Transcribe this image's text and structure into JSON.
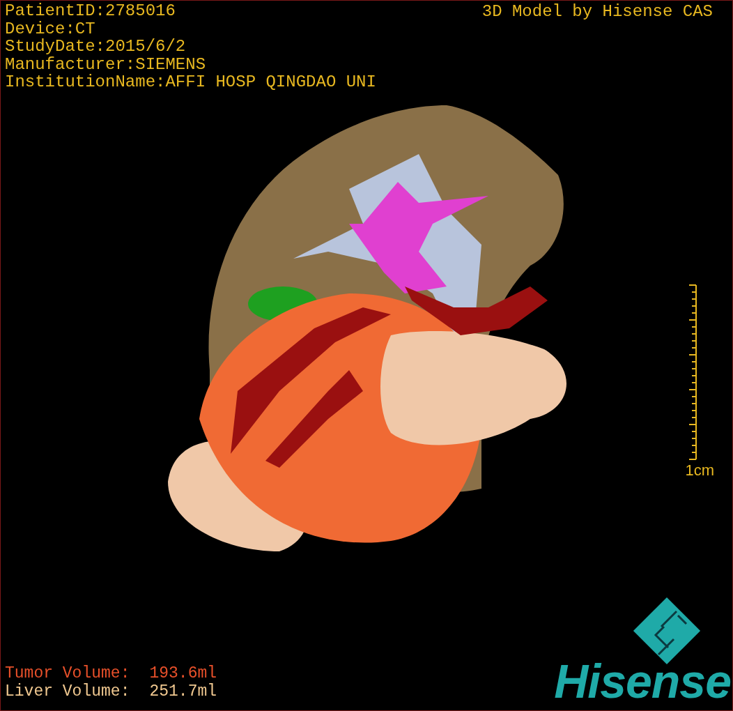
{
  "study_info": [
    "PatientID:2785016",
    "Device:CT",
    "StudyDate:2015/6/2",
    "Manufacturer:SIEMENS",
    "InstitutionName:AFFI HOSP QINGDAO UNI"
  ],
  "model_credit": "3D Model by Hisense CAS",
  "scale": {
    "label": "1cm"
  },
  "volumes": [
    {
      "label": "Tumor Volume:",
      "value": "193.6ml",
      "color": "#e8502a"
    },
    {
      "label": "Liver Volume:",
      "value": "251.7ml",
      "color": "#f0c890"
    }
  ],
  "brand": "Hisense"
}
